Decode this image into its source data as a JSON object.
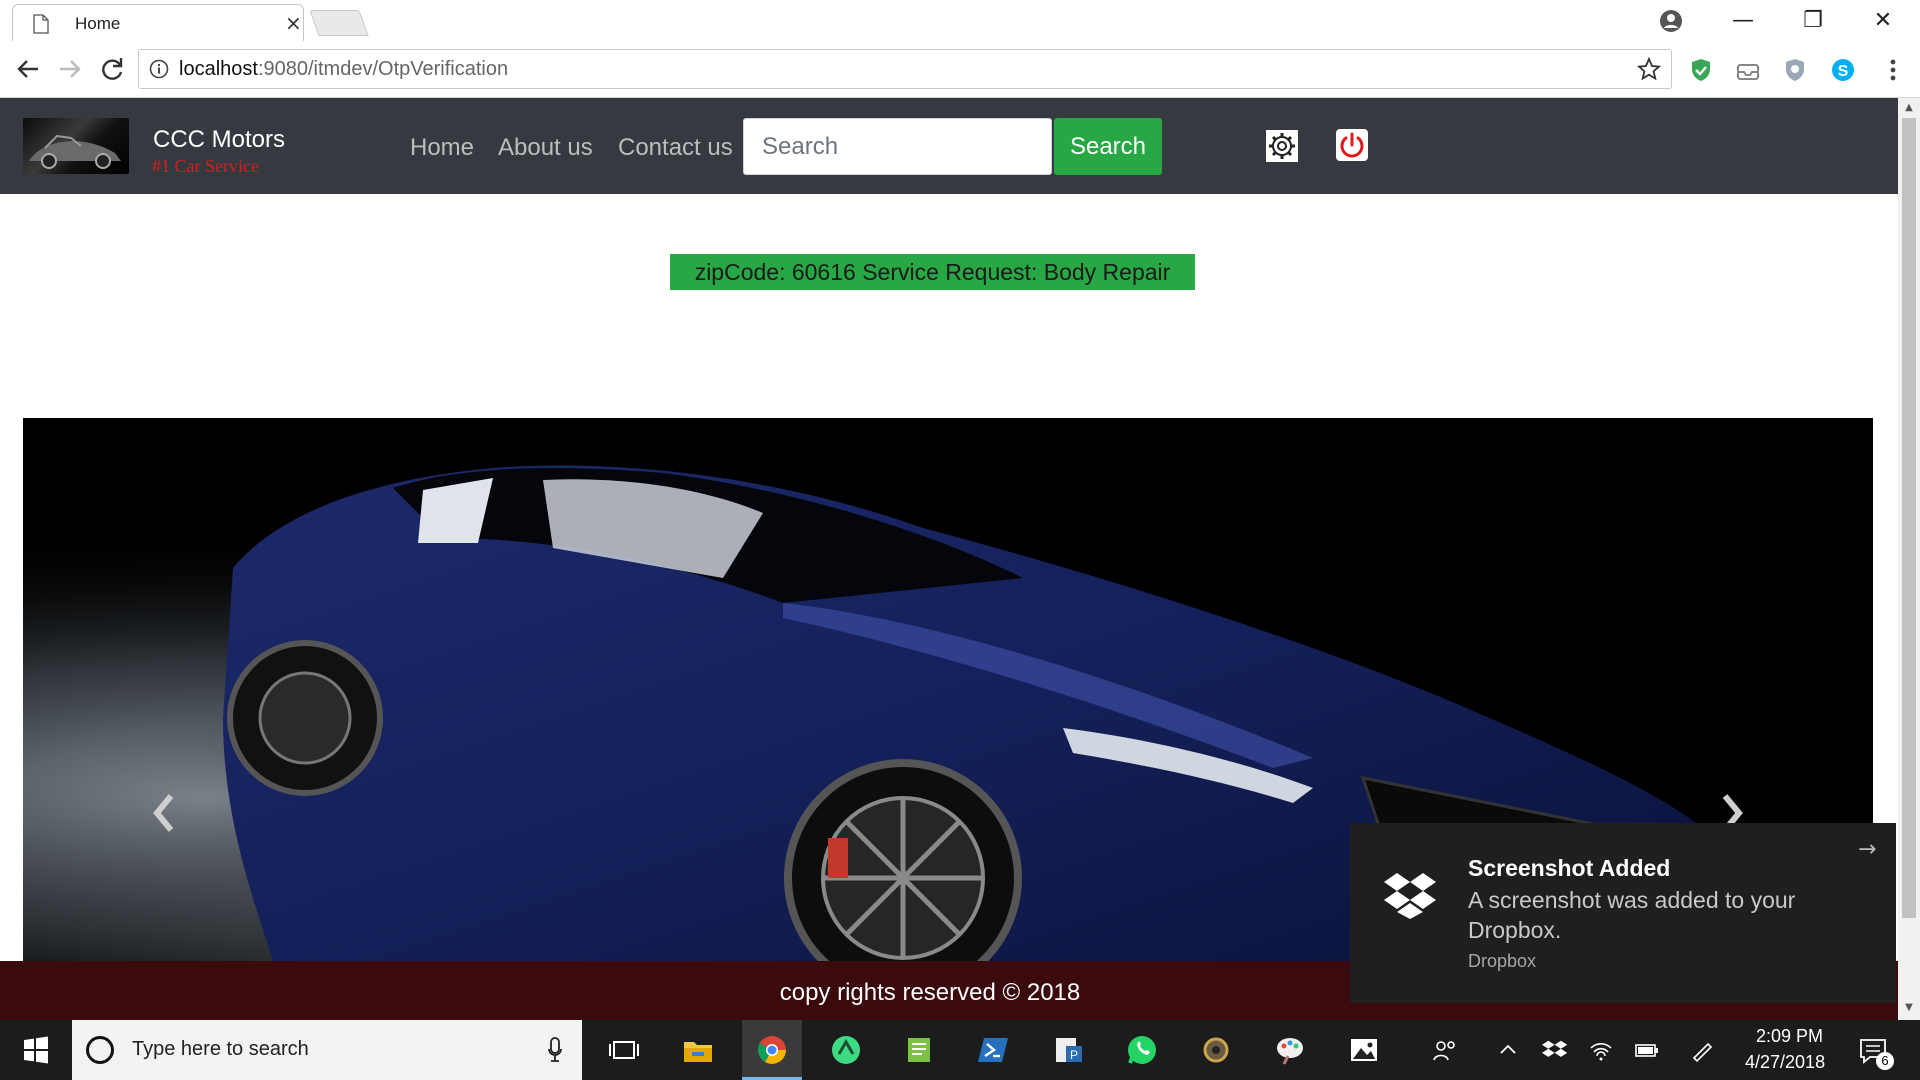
{
  "browser": {
    "tab_title": "Home",
    "tab_close": "×",
    "url_host": "localhost",
    "url_rest": ":9080/itmdev/OtpVerification",
    "window_controls": {
      "minimize": "—",
      "restore": "❐",
      "close": "✕"
    }
  },
  "navbar": {
    "brand_name": "CCC Motors",
    "brand_tagline": "#1 Car Service",
    "links": [
      {
        "label": "Home"
      },
      {
        "label": "About us"
      },
      {
        "label": "Contact us"
      }
    ],
    "search": {
      "placeholder": "Search",
      "button_label": "Search"
    },
    "icons": [
      "gear-icon",
      "power-icon"
    ],
    "colors": {
      "navbar_bg": "#343a40",
      "accent_green": "#28a745",
      "tagline_red": "#e0191b",
      "power_red": "#e0191b"
    }
  },
  "banner": {
    "text": "zipCode: 60616 Service Request: Body Repair"
  },
  "carousel": {
    "prev_icon": "chevron-left-icon",
    "next_icon": "chevron-right-icon"
  },
  "footer": {
    "text": "copy rights reserved © 2018",
    "bg_color": "#3a0a0c"
  },
  "toast": {
    "title": "Screenshot Added",
    "body": "A screenshot was added to your Dropbox.",
    "source": "Dropbox",
    "arrow": "→"
  },
  "taskbar": {
    "search_placeholder": "Type here to search",
    "time": "2:09 PM",
    "date": "4/27/2018",
    "notification_count": "6",
    "apps": [
      "task-view-icon",
      "file-explorer-icon",
      "chrome-icon",
      "android-studio-icon",
      "notepad-icon",
      "powershell-icon",
      "app-icon",
      "whatsapp-icon",
      "settings-app-icon",
      "paint-icon",
      "photos-icon"
    ]
  }
}
